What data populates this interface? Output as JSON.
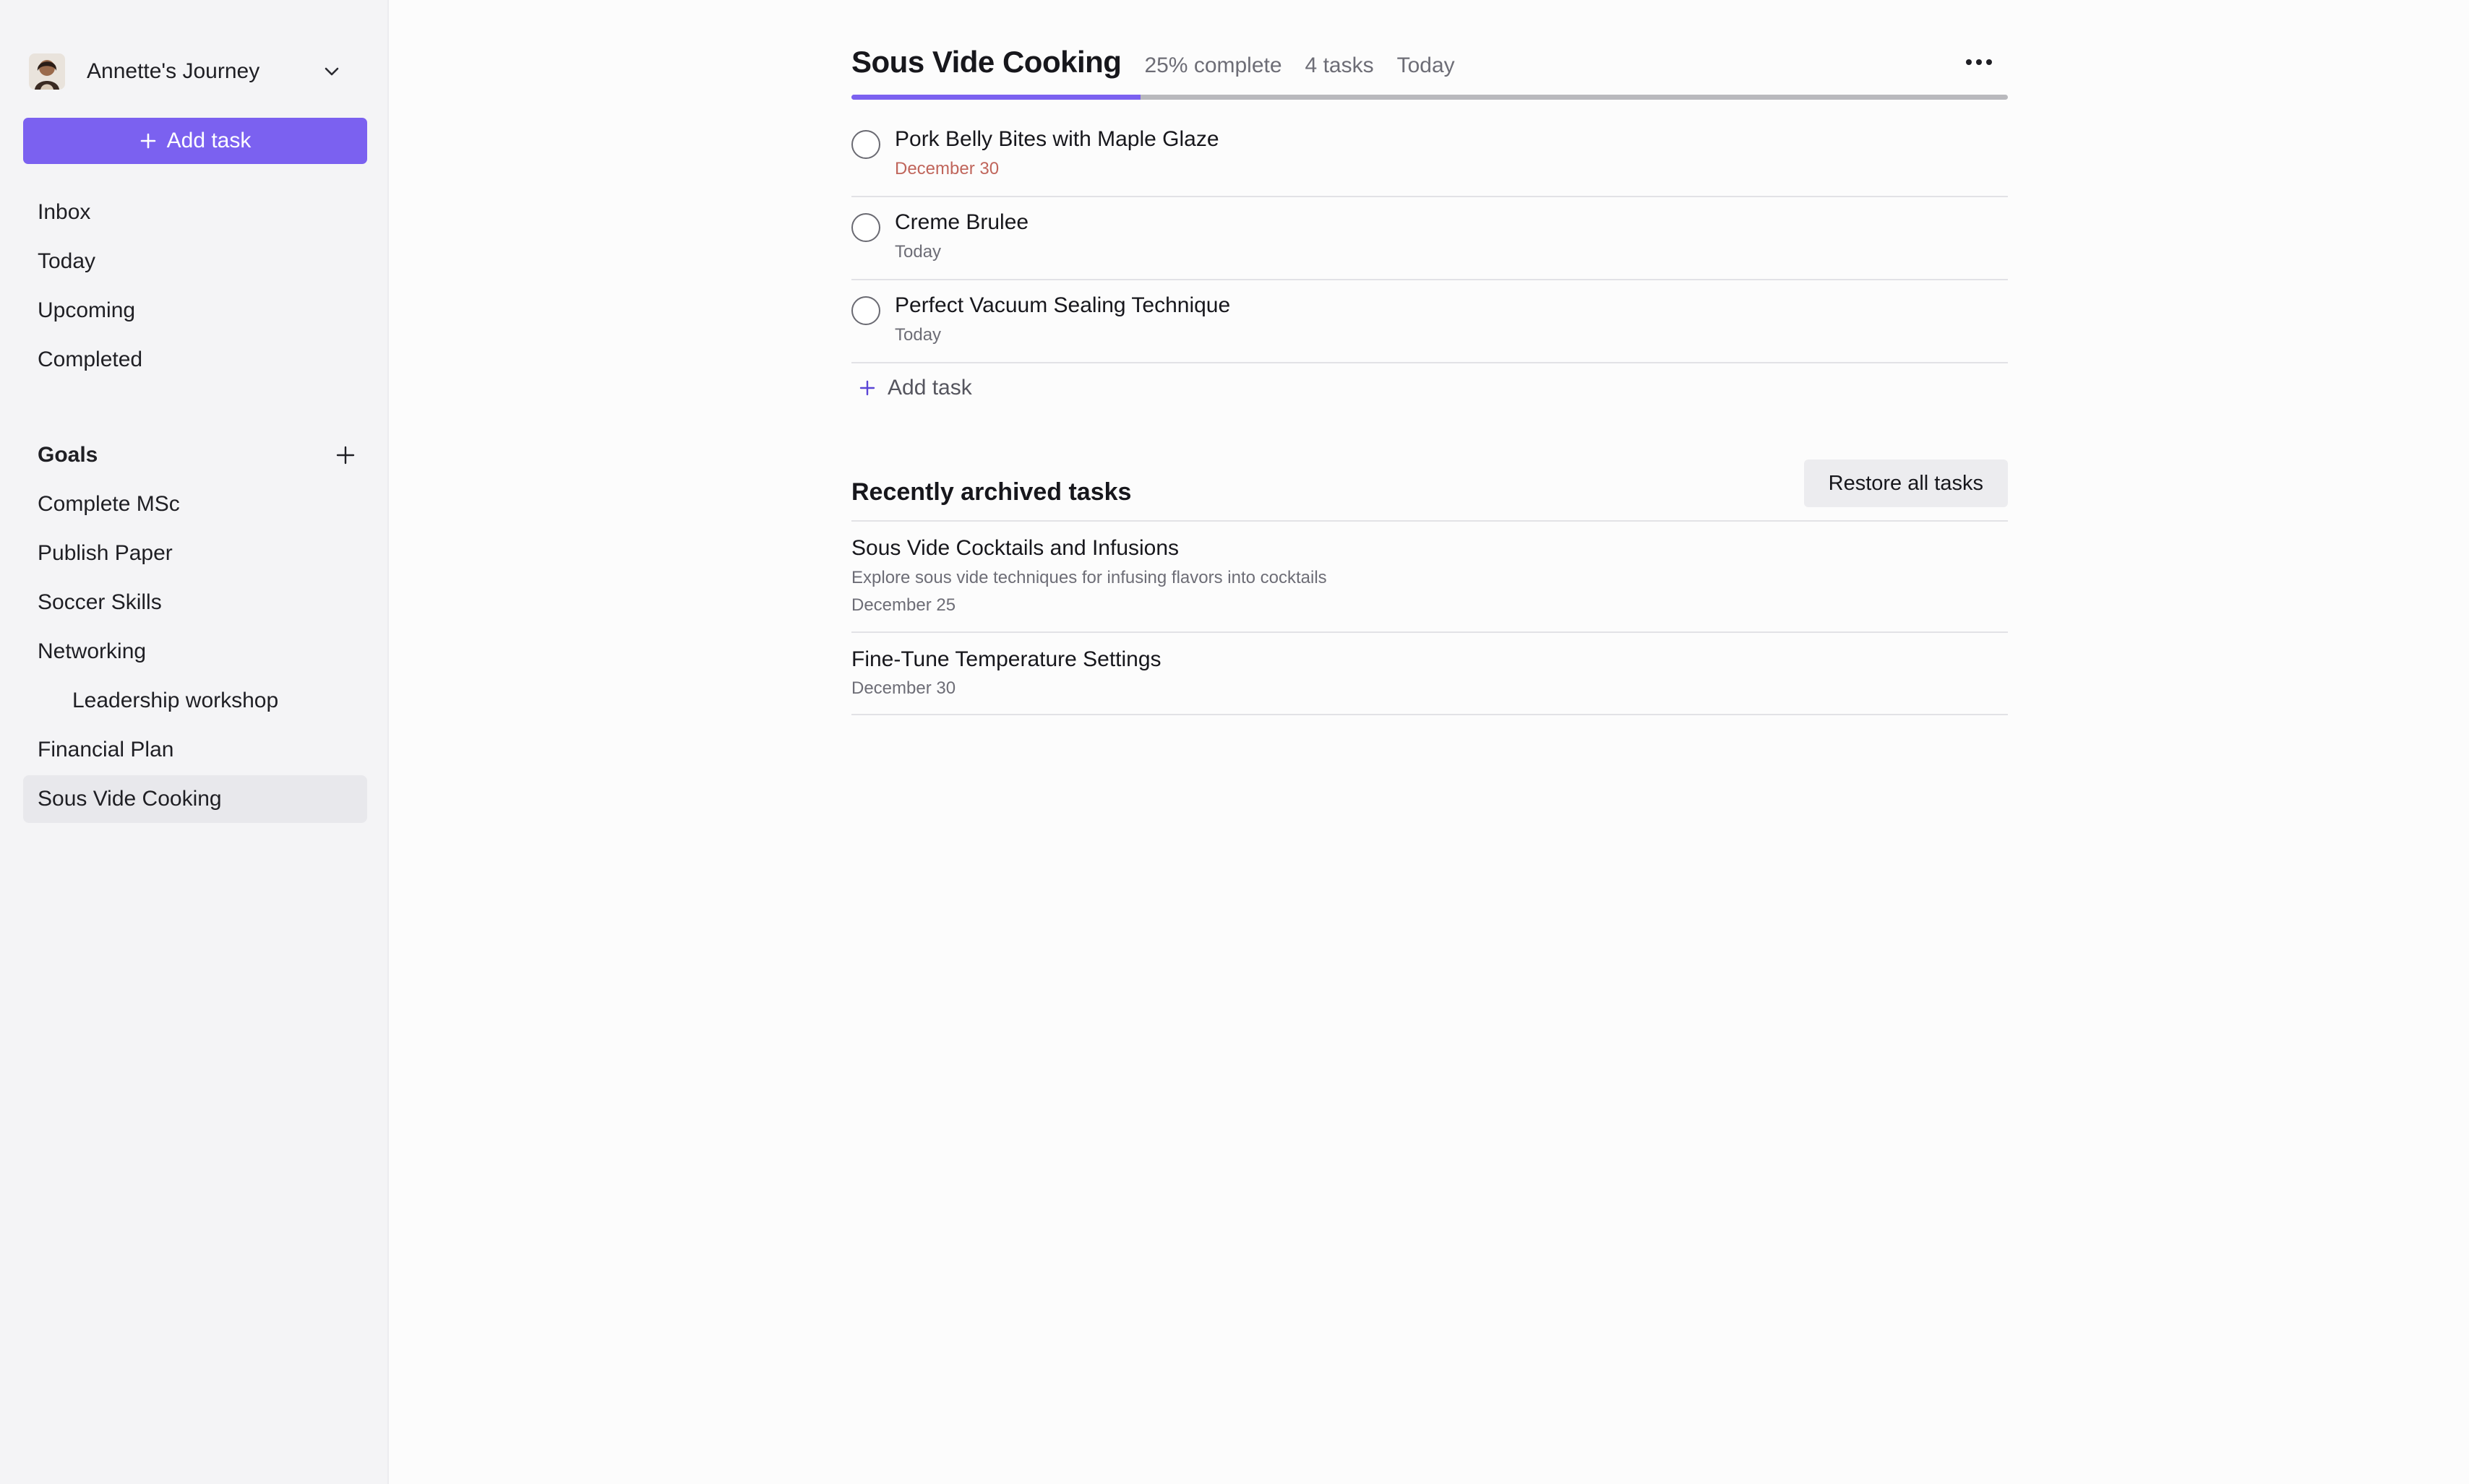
{
  "sidebar": {
    "workspace_name": "Annette's Journey",
    "add_task_label": "Add task",
    "nav": [
      "Inbox",
      "Today",
      "Upcoming",
      "Completed"
    ],
    "goals_title": "Goals",
    "goals": [
      {
        "label": "Complete MSc"
      },
      {
        "label": "Publish Paper"
      },
      {
        "label": "Soccer Skills"
      },
      {
        "label": "Networking"
      },
      {
        "label": "Leadership workshop",
        "sub": true
      },
      {
        "label": "Financial Plan"
      },
      {
        "label": "Sous Vide Cooking",
        "active": true
      }
    ]
  },
  "project": {
    "title": "Sous Vide Cooking",
    "progress_text": "25% complete",
    "progress_fraction": 0.25,
    "task_count": "4 tasks",
    "date": "Today"
  },
  "tasks": [
    {
      "title": "Pork Belly Bites with Maple Glaze",
      "due": "December 30",
      "overdue": true
    },
    {
      "title": "Creme Brulee",
      "due": "Today",
      "overdue": false
    },
    {
      "title": "Perfect Vacuum Sealing Technique",
      "due": "Today",
      "overdue": false
    }
  ],
  "add_task_label": "Add task",
  "archived": {
    "title": "Recently archived tasks",
    "restore_label": "Restore all tasks",
    "items": [
      {
        "title": "Sous Vide Cocktails and Infusions",
        "description": "Explore sous vide techniques for infusing flavors into cocktails",
        "date": "December 25"
      },
      {
        "title": "Fine-Tune Temperature Settings",
        "date": "December 30"
      }
    ]
  },
  "colors": {
    "accent": "#7b61f0",
    "overdue": "#c0655b",
    "sidebar_bg": "#f4f4f6"
  },
  "icons": {
    "workspace_chevron": "chevron-down-icon",
    "add": "plus-icon",
    "more": "more-horizontal-icon",
    "task_check": "circle-checkbox-icon"
  }
}
